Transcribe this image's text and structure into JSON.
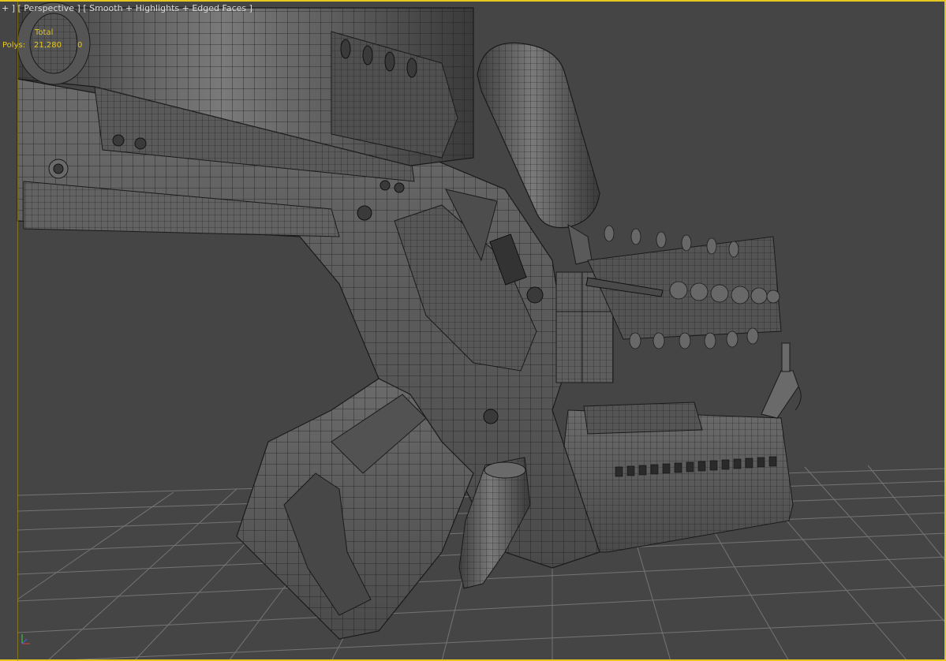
{
  "viewport": {
    "label_plus": "+ ]",
    "label_view": "[ Perspective ]",
    "label_shading": "[ Smooth + Highlights + Edged Faces ]",
    "stats": {
      "total_label": "Total",
      "polys_label": "Polys:",
      "polys_total": "21,280",
      "polys_selected": "0"
    },
    "colors": {
      "background": "#454545",
      "active_border": "#e6c81e",
      "grid": "#7a7a7a",
      "wireframe": "#1a1a1a",
      "model_surface": "#5c5c5c"
    },
    "icons": [
      "axis-tripod-icon"
    ]
  }
}
